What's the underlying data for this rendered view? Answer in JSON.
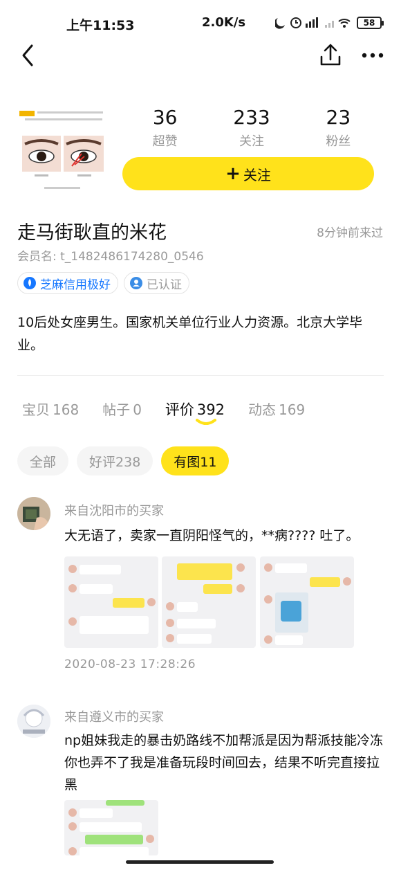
{
  "status_bar": {
    "time": "上午11:53",
    "network_speed": "2.0K/s",
    "battery": "58"
  },
  "nav": {
    "back_icon": "chevron-left-icon",
    "share_icon": "share-icon",
    "more_icon": "more-icon"
  },
  "profile": {
    "stats": [
      {
        "value": "36",
        "label": "超赞"
      },
      {
        "value": "233",
        "label": "关注"
      },
      {
        "value": "23",
        "label": "粉丝"
      }
    ],
    "follow_label": "关注",
    "follow_plus": "+",
    "username": "走马街耿直的米花",
    "last_seen": "8分钟前来过",
    "member_id": "会员名: t_1482486174280_0546",
    "badges": [
      {
        "label": "芝麻信用极好",
        "icon": "sesame-credit-icon",
        "color": "#1677ff"
      },
      {
        "label": "已认证",
        "icon": "verified-icon",
        "color": "#999999"
      }
    ],
    "bio": "10后处女座男生。国家机关单位行业人力资源。北京大学毕业。"
  },
  "tabs": [
    {
      "label": "宝贝",
      "count": "168",
      "active": false
    },
    {
      "label": "帖子",
      "count": "0",
      "active": false
    },
    {
      "label": "评价",
      "count": "392",
      "active": true
    },
    {
      "label": "动态",
      "count": "169",
      "active": false
    }
  ],
  "filters": [
    {
      "label": "全部",
      "active": false
    },
    {
      "label": "好评238",
      "active": false
    },
    {
      "label": "有图11",
      "active": true
    }
  ],
  "reviews": [
    {
      "from": "来自沈阳市的买家",
      "text": "大无语了，卖家一直阴阳怪气的，**病???? 吐了。",
      "date": "2020-08-23 17:28:26",
      "image_count": 3
    },
    {
      "from": "来自遵义市的买家",
      "text": "np姐妹我走的暴击奶路线不加帮派是因为帮派技能冷冻你也弄不了我是准备玩段时间回去，结果不听完直接拉黑",
      "image_count": 1
    }
  ],
  "colors": {
    "accent": "#FFE21B",
    "muted_text": "#999999",
    "credit_blue": "#1677ff"
  }
}
